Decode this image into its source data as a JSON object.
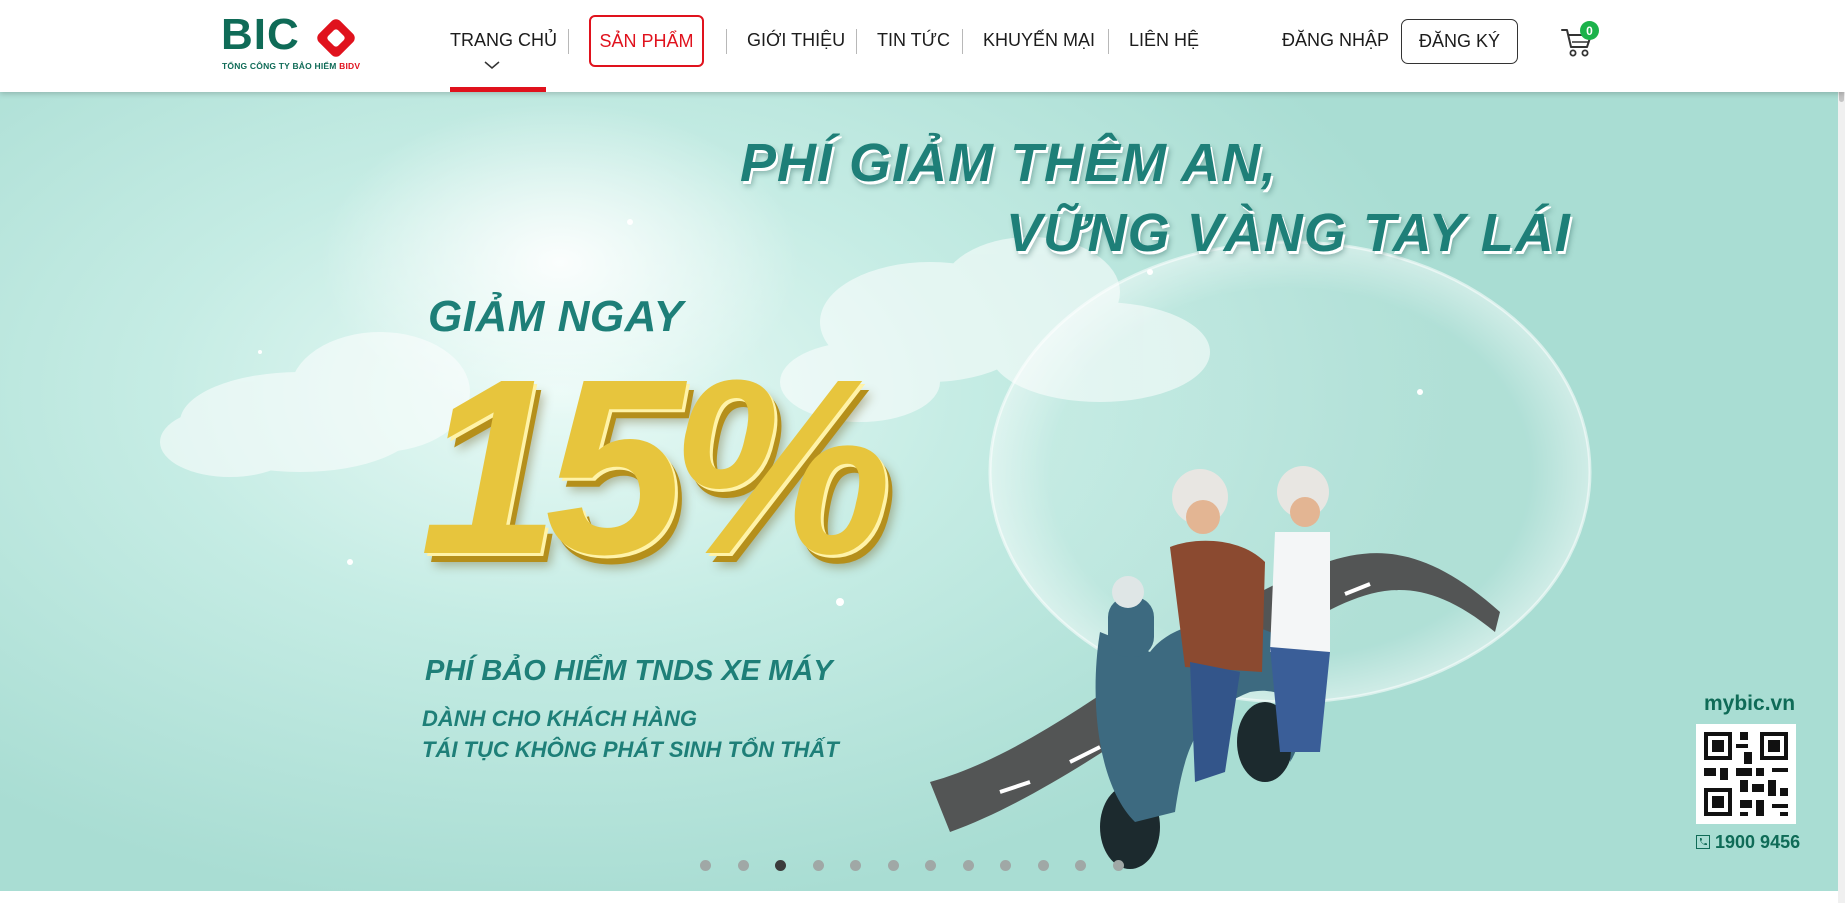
{
  "logo": {
    "brand": "BIC",
    "tagline_prefix": "TỔNG CÔNG TY BẢO HIỂM",
    "tagline_brand": "BIDV"
  },
  "nav": {
    "items": [
      "TRANG CHỦ",
      "SẢN PHẨM",
      "GIỚI THIỆU",
      "TIN TỨC",
      "KHUYẾN MẠI",
      "LIÊN HỆ"
    ],
    "active_index": 0
  },
  "auth": {
    "login": "ĐĂNG NHẬP",
    "register": "ĐĂNG KÝ"
  },
  "cart": {
    "count": "0"
  },
  "banner": {
    "headline_line1": "PHÍ GIẢM THÊM AN,",
    "headline_line2": "VỮNG VÀNG TAY LÁI",
    "discount_label": "GIẢM NGAY",
    "discount_value": "15%",
    "product": "PHÍ BẢO HIỂM TNDS XE MÁY",
    "note_line1": "DÀNH CHO KHÁCH HÀNG",
    "note_line2": "TÁI TỤC KHÔNG PHÁT SINH  TỔN THẤT",
    "site": "mybic.vn",
    "hotline": "1900 9456"
  },
  "carousel": {
    "slide_count": 12,
    "active_index": 2
  },
  "colors": {
    "brand_green": "#0f6b57",
    "accent_red": "#e0121d",
    "banner_teal": "#1e7f78",
    "gold": "#e7c53d",
    "badge_green": "#1bb24a"
  }
}
